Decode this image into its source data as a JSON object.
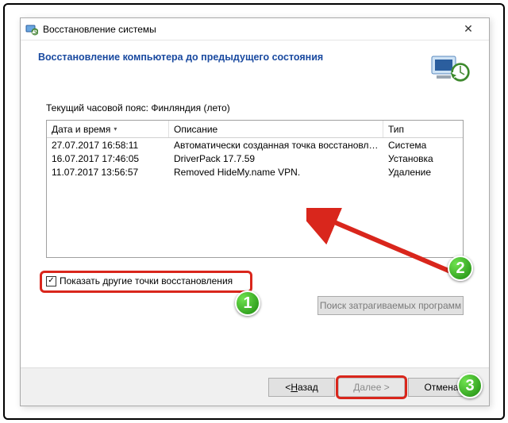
{
  "titlebar": {
    "title": "Восстановление системы"
  },
  "header": {
    "title": "Восстановление компьютера до предыдущего состояния"
  },
  "timezone_line": "Текущий часовой пояс: Финляндия (лето)",
  "columns": {
    "date": "Дата и время",
    "desc": "Описание",
    "type": "Тип"
  },
  "rows": [
    {
      "date": "27.07.2017 16:58:11",
      "desc": "Автоматически созданная точка восстановле...",
      "type": "Система"
    },
    {
      "date": "16.07.2017 17:46:05",
      "desc": "DriverPack 17.7.59",
      "type": "Установка"
    },
    {
      "date": "11.07.2017 13:56:57",
      "desc": "Removed HideMy.name VPN.",
      "type": "Удаление"
    }
  ],
  "checkbox": {
    "checked": true,
    "label": "Показать другие точки восстановления"
  },
  "affected_btn": "Поиск затрагиваемых программ",
  "footer": {
    "back_prefix": "< ",
    "back_mn": "Н",
    "back_rest": "азад",
    "next_prefix": "",
    "next_mn": "Д",
    "next_rest": "алее >",
    "cancel": "Отмена"
  },
  "badges": {
    "b1": "1",
    "b2": "2",
    "b3": "3"
  }
}
